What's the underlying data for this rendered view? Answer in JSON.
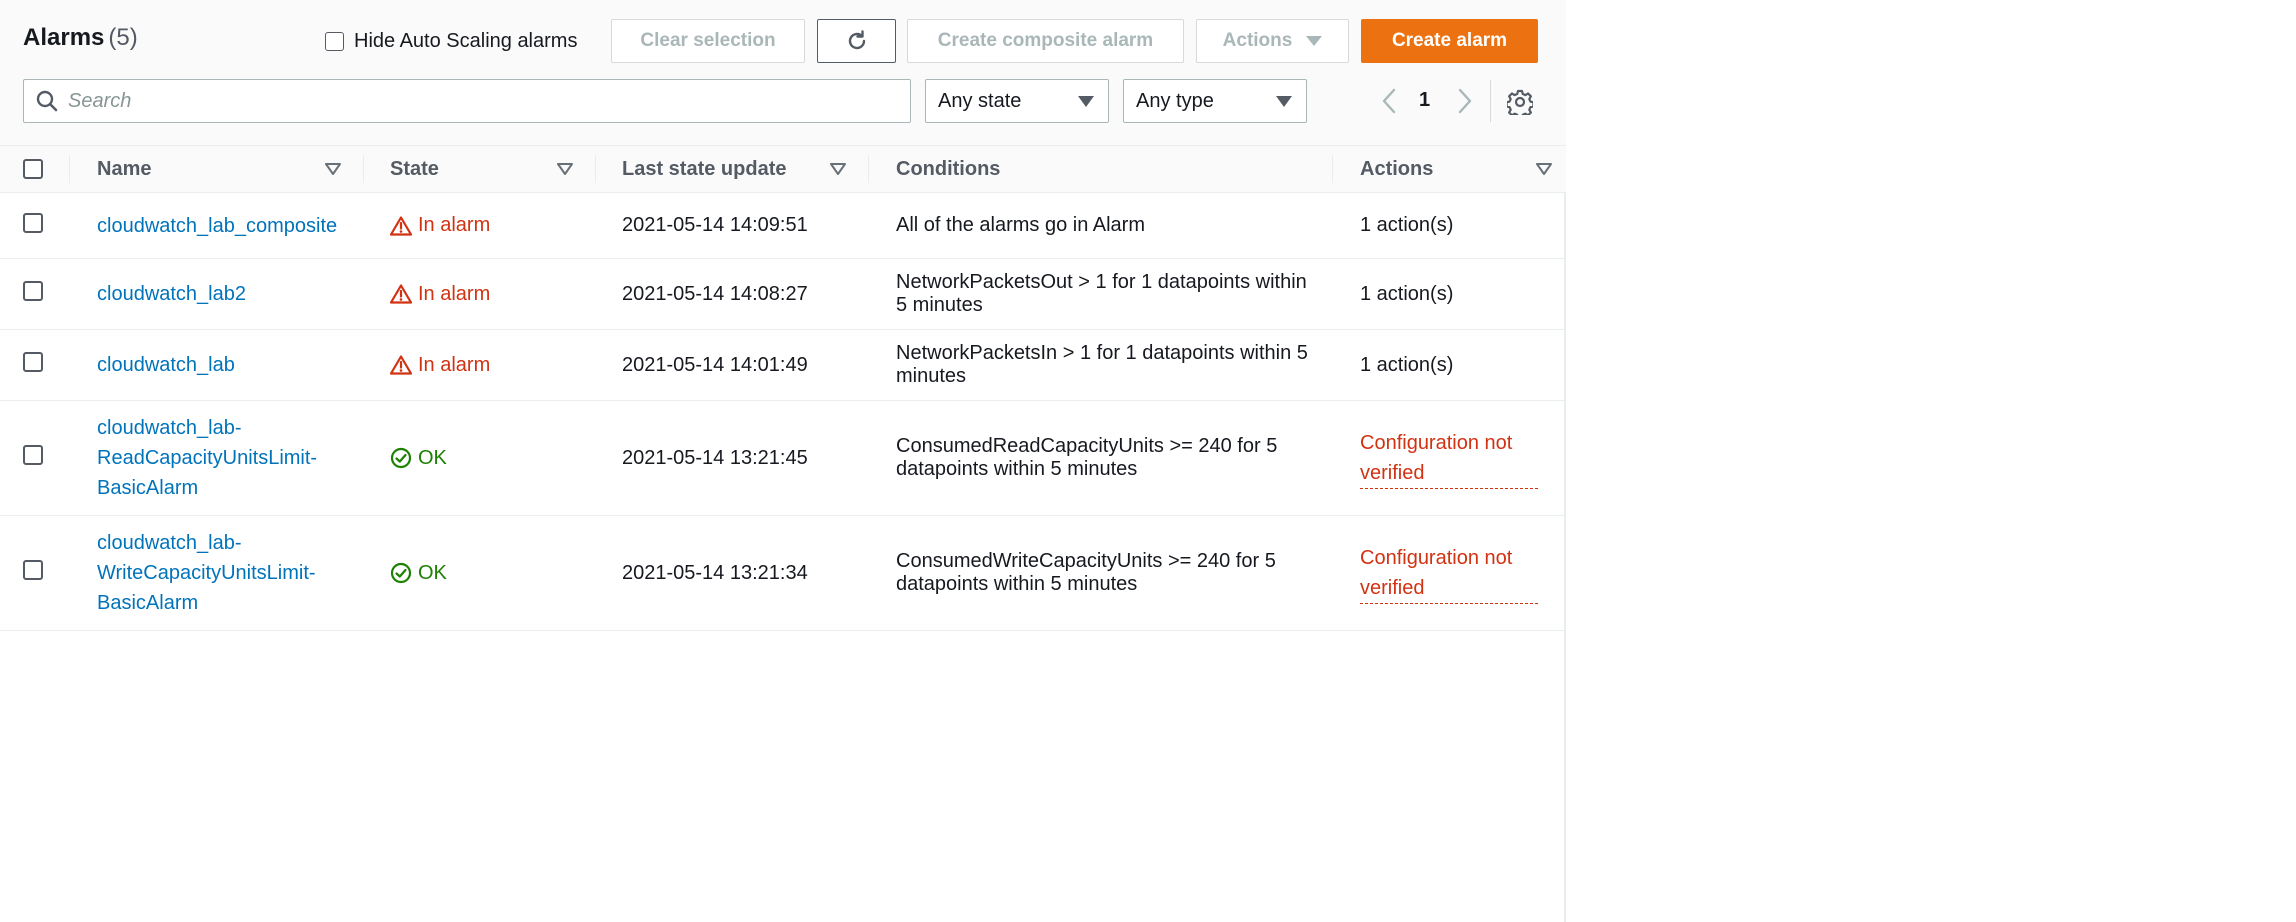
{
  "header": {
    "title": "Alarms",
    "count": "(5)",
    "hide_autoscaling_label": "Hide Auto Scaling alarms",
    "buttons": {
      "clear_selection": "Clear selection",
      "create_composite": "Create composite alarm",
      "actions": "Actions",
      "create_alarm": "Create alarm"
    },
    "search_placeholder": "Search",
    "state_filter": "Any state",
    "type_filter": "Any type",
    "page": "1"
  },
  "columns": {
    "name": "Name",
    "state": "State",
    "last_update": "Last state update",
    "conditions": "Conditions",
    "actions": "Actions"
  },
  "rows": [
    {
      "name_lines": [
        "cloudwatch_lab_composite"
      ],
      "state": "In alarm",
      "state_kind": "alarm",
      "last_update": "2021-05-14 14:09:51",
      "condition_lines": [
        "All of the alarms go in Alarm"
      ],
      "actions_lines": [
        "1 action(s)"
      ],
      "actions_kind": "normal"
    },
    {
      "name_lines": [
        "cloudwatch_lab2"
      ],
      "state": "In alarm",
      "state_kind": "alarm",
      "last_update": "2021-05-14 14:08:27",
      "condition_lines": [
        "NetworkPacketsOut > 1 for 1 datapoints within",
        "5 minutes"
      ],
      "actions_lines": [
        "1 action(s)"
      ],
      "actions_kind": "normal"
    },
    {
      "name_lines": [
        "cloudwatch_lab"
      ],
      "state": "In alarm",
      "state_kind": "alarm",
      "last_update": "2021-05-14 14:01:49",
      "condition_lines": [
        "NetworkPacketsIn > 1 for 1 datapoints within 5",
        "minutes"
      ],
      "actions_lines": [
        "1 action(s)"
      ],
      "actions_kind": "normal"
    },
    {
      "name_lines": [
        "cloudwatch_lab-",
        "ReadCapacityUnitsLimit-",
        "BasicAlarm"
      ],
      "state": "OK",
      "state_kind": "ok",
      "last_update": "2021-05-14 13:21:45",
      "condition_lines": [
        "ConsumedReadCapacityUnits >= 240 for 5",
        "datapoints within 5 minutes"
      ],
      "actions_lines": [
        "Configuration not",
        "verified"
      ],
      "actions_kind": "error"
    },
    {
      "name_lines": [
        "cloudwatch_lab-",
        "WriteCapacityUnitsLimit-",
        "BasicAlarm"
      ],
      "state": "OK",
      "state_kind": "ok",
      "last_update": "2021-05-14 13:21:34",
      "condition_lines": [
        "ConsumedWriteCapacityUnits >= 240 for 5",
        "datapoints within 5 minutes"
      ],
      "actions_lines": [
        "Configuration not",
        "verified"
      ],
      "actions_kind": "error"
    }
  ],
  "colors": {
    "primary": "#ec7211",
    "link": "#0073bb",
    "alarm": "#d13212",
    "ok": "#1d8102"
  }
}
